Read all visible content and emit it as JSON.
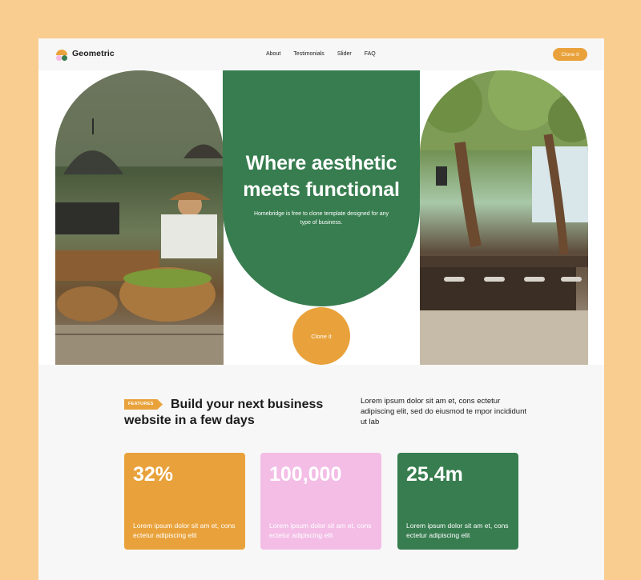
{
  "brand": {
    "name": "Geometric"
  },
  "nav": {
    "links": [
      "About",
      "Testimonials",
      "Slider",
      "FAQ"
    ],
    "cta": "Clone it"
  },
  "hero": {
    "title_line1": "Where aesthetic",
    "title_line2": "meets functional",
    "subtitle": "Homebridge is free to clone template designed for any type of business.",
    "cta": "Clone it",
    "left_image_icon": "outdoor-kitchen-photo",
    "right_image_icon": "garden-bar-photo"
  },
  "features": {
    "tag": "FEATURES",
    "heading": "Build your next business website in a few days",
    "description": "Lorem ipsum dolor sit am et, cons ectetur adipiscing elit, sed do eiusmod te mpor incididunt ut lab"
  },
  "stats": [
    {
      "value": "32%",
      "text": "Lorem ipsum dolor sit am et, cons ectetur adipiscing elit",
      "color": "#e9a23b"
    },
    {
      "value": "100,000",
      "text": "Lorem ipsum dolor sit am et, cons ectetur adipiscing elit",
      "color": "#f3bde6"
    },
    {
      "value": "25.4m",
      "text": "Lorem ipsum dolor sit am et, cons ectetur adipiscing elit",
      "color": "#377d4f"
    }
  ],
  "colors": {
    "background": "#f9cc8f",
    "accent_orange": "#e9a23b",
    "accent_green": "#377d4f",
    "accent_pink": "#f3bde6"
  }
}
